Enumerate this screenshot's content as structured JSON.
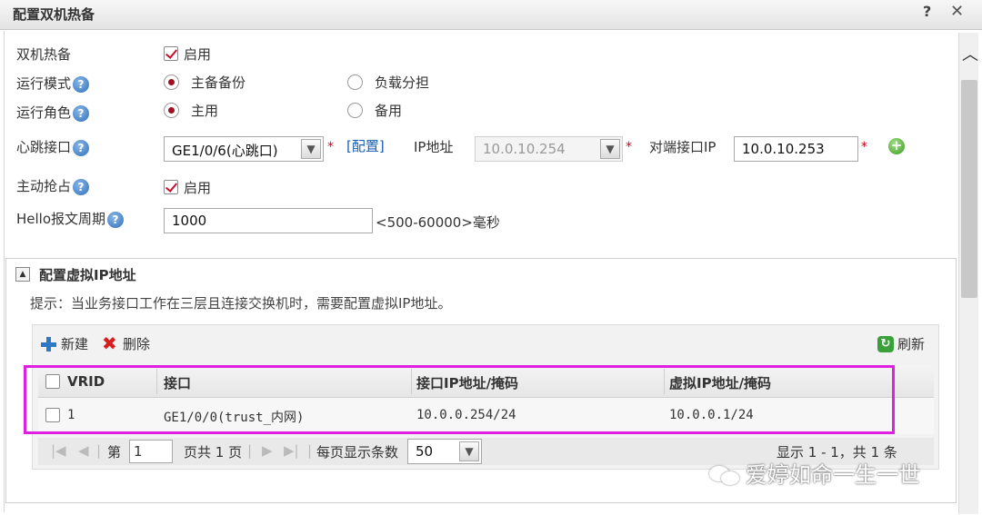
{
  "window": {
    "title": "配置双机热备",
    "help": "?",
    "close": "✕"
  },
  "form": {
    "hot_standby": {
      "label": "双机热备",
      "checkbox_label": "启用",
      "checked": true
    },
    "run_mode": {
      "label": "运行模式",
      "options": [
        "主备备份",
        "负载分担"
      ],
      "selected": "主备备份"
    },
    "run_role": {
      "label": "运行角色",
      "options": [
        "主用",
        "备用"
      ],
      "selected": "主用"
    },
    "heartbeat": {
      "label": "心跳接口",
      "interface": "GE1/0/6(心跳口)",
      "config_link": "[配置]",
      "ip_label": "IP地址",
      "ip_value": "10.0.10.254",
      "peer_label": "对端接口IP",
      "peer_value": "10.0.10.253"
    },
    "preempt": {
      "label": "主动抢占",
      "checkbox_label": "启用",
      "checked": true
    },
    "hello": {
      "label": "Hello报文周期",
      "value": "1000",
      "hint": "<500-60000>毫秒"
    }
  },
  "vip_section": {
    "title": "配置虚拟IP地址",
    "hint": "提示：当业务接口工作在三层且连接交换机时，需要配置虚拟IP地址。",
    "toolbar": {
      "new": "新建",
      "delete": "删除",
      "refresh": "刷新"
    },
    "columns": [
      "VRID",
      "接口",
      "接口IP地址/掩码",
      "虚拟IP地址/掩码"
    ],
    "rows": [
      {
        "vrid": "1",
        "interface": "GE1/0/0(trust_内网)",
        "ip_mask": "10.0.0.254/24",
        "vip_mask": "10.0.0.1/24"
      }
    ],
    "pager": {
      "page_prefix": "第",
      "page": "1",
      "page_suffix": "页共 1 页",
      "per_page_label": "每页显示条数",
      "per_page": "50",
      "summary": "显示 1 - 1，共 1 条"
    }
  },
  "watermark": "爱婷如命一生一世",
  "colors": {
    "highlight": "#e020e0",
    "link": "#1a5fb4",
    "required": "#d0021b"
  }
}
